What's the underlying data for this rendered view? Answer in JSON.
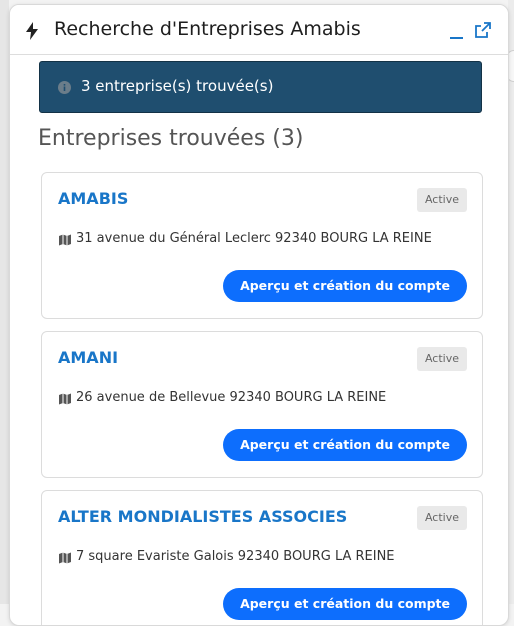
{
  "header": {
    "title": "Recherche d'Entreprises Amabis",
    "icons": [
      "bolt-icon",
      "minimize-icon",
      "popout-icon"
    ]
  },
  "alert": {
    "text": "3 entreprise(s) trouvée(s)",
    "icon": "info-icon"
  },
  "section": {
    "title": "Entreprises trouvées (3)"
  },
  "companies": [
    {
      "name": "AMABIS",
      "status": "Active",
      "address": "31 avenue du Général Leclerc 92340 BOURG LA REINE",
      "button_label": "Aperçu et création du compte"
    },
    {
      "name": "AMANI",
      "status": "Active",
      "address": "26 avenue de Bellevue 92340 BOURG LA REINE",
      "button_label": "Aperçu et création du compte"
    },
    {
      "name": "ALTER MONDIALISTES ASSOCIES",
      "status": "Active",
      "address": "7 square Evariste Galois 92340 BOURG LA REINE",
      "button_label": "Aperçu et création du compte"
    }
  ],
  "colors": {
    "alert_bg": "#1f4e6f",
    "link": "#1976c8",
    "button": "#0d6efd",
    "badge_bg": "#e9e9e9"
  }
}
